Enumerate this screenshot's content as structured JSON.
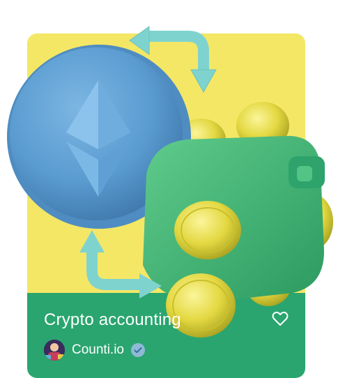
{
  "card": {
    "title": "Crypto accounting",
    "author": "Counti.io",
    "colors": {
      "top_background": "#f4e766",
      "bottom_background": "#2aa56f",
      "coin_blue": "#5a9bd0",
      "wallet_green": "#3eb577",
      "gold": "#d9cf3a",
      "arrow": "#7fd3cf"
    },
    "icons": {
      "favorite": "heart-outline-icon",
      "verified": "verified-check-icon",
      "illustration": "ethereum-coin-wallet-illustration"
    }
  }
}
